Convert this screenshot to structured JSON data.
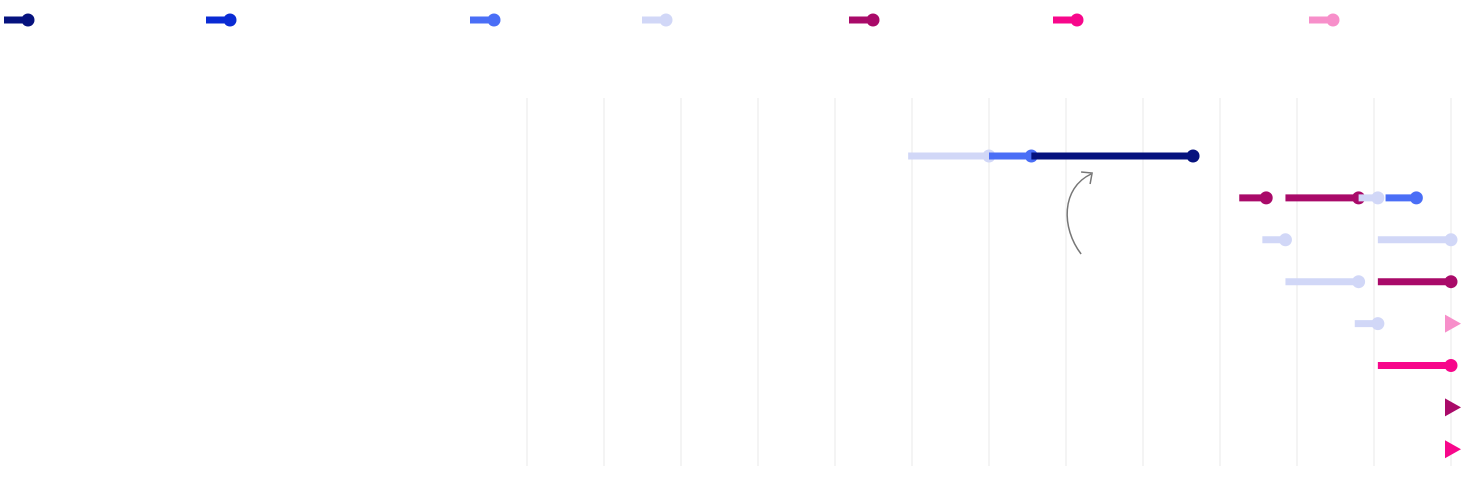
{
  "colors": {
    "navy": "#06127e",
    "blue": "#0a2bd4",
    "periwinkle": "#4a6ef6",
    "lavender": "#d1d7f7",
    "plum": "#a90a69",
    "pink": "#f7078b",
    "light_pink": "#f78fca",
    "grid": "#ececec",
    "annotation": "#777777"
  },
  "chart_data": {
    "type": "line",
    "legend": {
      "position": "top",
      "entries": [
        {
          "color": "navy",
          "text": ""
        },
        {
          "color": "blue",
          "text": ""
        },
        {
          "color": "periwinkle",
          "text": ""
        },
        {
          "color": "lavender",
          "text": ""
        },
        {
          "color": "plum",
          "text": ""
        },
        {
          "color": "pink",
          "text": ""
        },
        {
          "color": "light_pink",
          "text": ""
        }
      ]
    },
    "grid": true,
    "x_gridlines": [
      0,
      1,
      2,
      3,
      4,
      5,
      6,
      7,
      8,
      9,
      10,
      11,
      12
    ],
    "xlim": [
      0,
      12
    ],
    "rows": [
      {
        "segments": [
          {
            "color": "lavender",
            "start": 4.95,
            "end": 6.0
          },
          {
            "color": "periwinkle",
            "start": 6.0,
            "end": 6.55
          },
          {
            "color": "navy",
            "start": 6.55,
            "end": 8.65
          }
        ],
        "arrows": []
      },
      {
        "segments": [
          {
            "color": "plum",
            "start": 9.25,
            "end": 9.6
          },
          {
            "color": "plum",
            "start": 9.85,
            "end": 10.8
          },
          {
            "color": "lavender",
            "start": 10.8,
            "end": 11.05
          },
          {
            "color": "periwinkle",
            "start": 11.15,
            "end": 11.55
          }
        ],
        "arrows": []
      },
      {
        "segments": [
          {
            "color": "lavender",
            "start": 9.55,
            "end": 9.85
          },
          {
            "color": "lavender",
            "start": 11.05,
            "end": 12.0
          }
        ],
        "arrows": []
      },
      {
        "segments": [
          {
            "color": "lavender",
            "start": 9.85,
            "end": 10.8
          },
          {
            "color": "plum",
            "start": 11.05,
            "end": 12.0
          }
        ],
        "arrows": []
      },
      {
        "segments": [
          {
            "color": "lavender",
            "start": 10.75,
            "end": 11.05
          }
        ],
        "arrows": [
          {
            "color": "light_pink",
            "at": 12.0
          }
        ]
      },
      {
        "segments": [
          {
            "color": "pink",
            "start": 11.05,
            "end": 12.0
          }
        ],
        "arrows": []
      },
      {
        "segments": [],
        "arrows": [
          {
            "color": "plum",
            "at": 12.0
          }
        ]
      },
      {
        "segments": [],
        "arrows": [
          {
            "color": "pink",
            "at": 12.0
          }
        ]
      }
    ],
    "annotation": {
      "type": "curved-arrow",
      "near_row": 0,
      "near_x": 7.3,
      "text": ""
    }
  }
}
